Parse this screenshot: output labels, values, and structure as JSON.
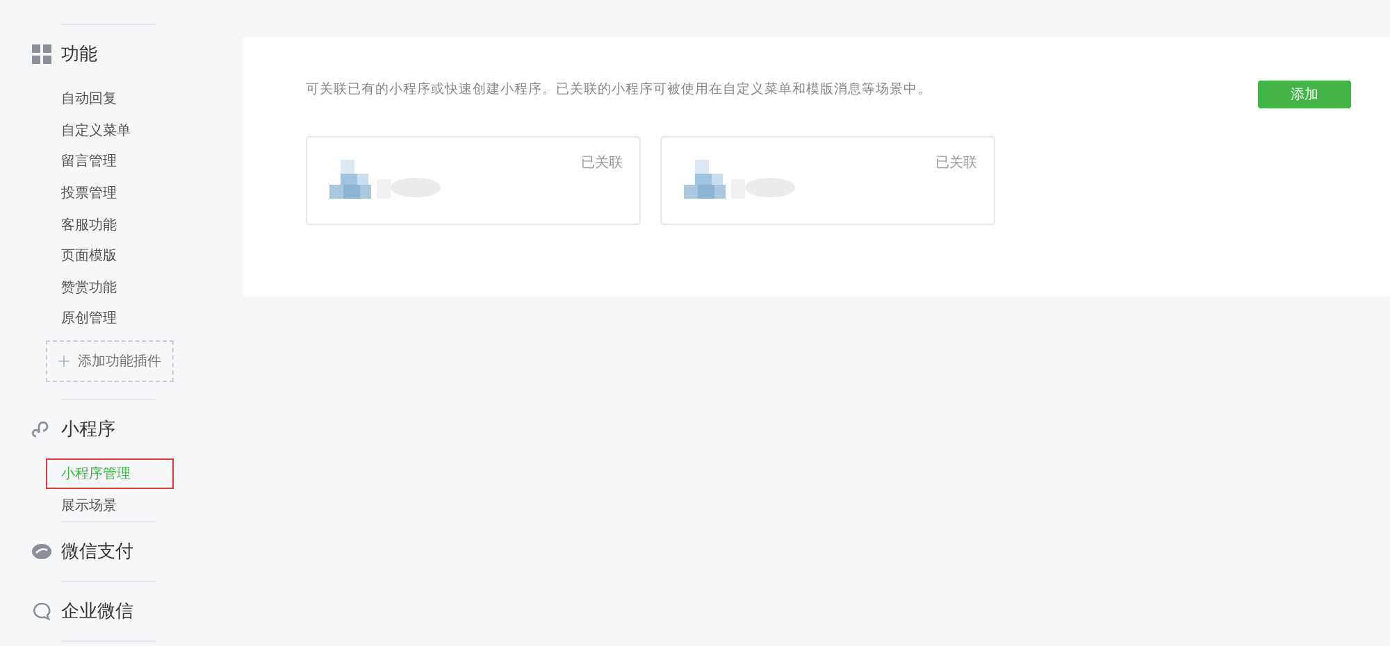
{
  "sidebar": {
    "groups": [
      {
        "kind": "grid",
        "title": "功能",
        "items": [
          {
            "label": "自动回复",
            "selected": false
          },
          {
            "label": "自定义菜单",
            "selected": false
          },
          {
            "label": "留言管理",
            "selected": false
          },
          {
            "label": "投票管理",
            "selected": false
          },
          {
            "label": "客服功能",
            "selected": false
          },
          {
            "label": "页面模版",
            "selected": false
          },
          {
            "label": "赞赏功能",
            "selected": false
          },
          {
            "label": "原创管理",
            "selected": false
          }
        ],
        "add_plugin": "添加功能插件"
      },
      {
        "kind": "link",
        "title": "小程序",
        "items": [
          {
            "label": "小程序管理",
            "selected": true
          },
          {
            "label": "展示场景",
            "selected": false
          }
        ]
      },
      {
        "kind": "pay",
        "title": "微信支付"
      },
      {
        "kind": "chat",
        "title": "企业微信"
      }
    ]
  },
  "main": {
    "description": "可关联已有的小程序或快速创建小程序。已关联的小程序可被使用在自定义菜单和模版消息等场景中。",
    "add_button": "添加",
    "apps": [
      {
        "kind": "picture",
        "status": "已关联"
      },
      {
        "kind": "picture",
        "status": "已关联"
      }
    ]
  }
}
